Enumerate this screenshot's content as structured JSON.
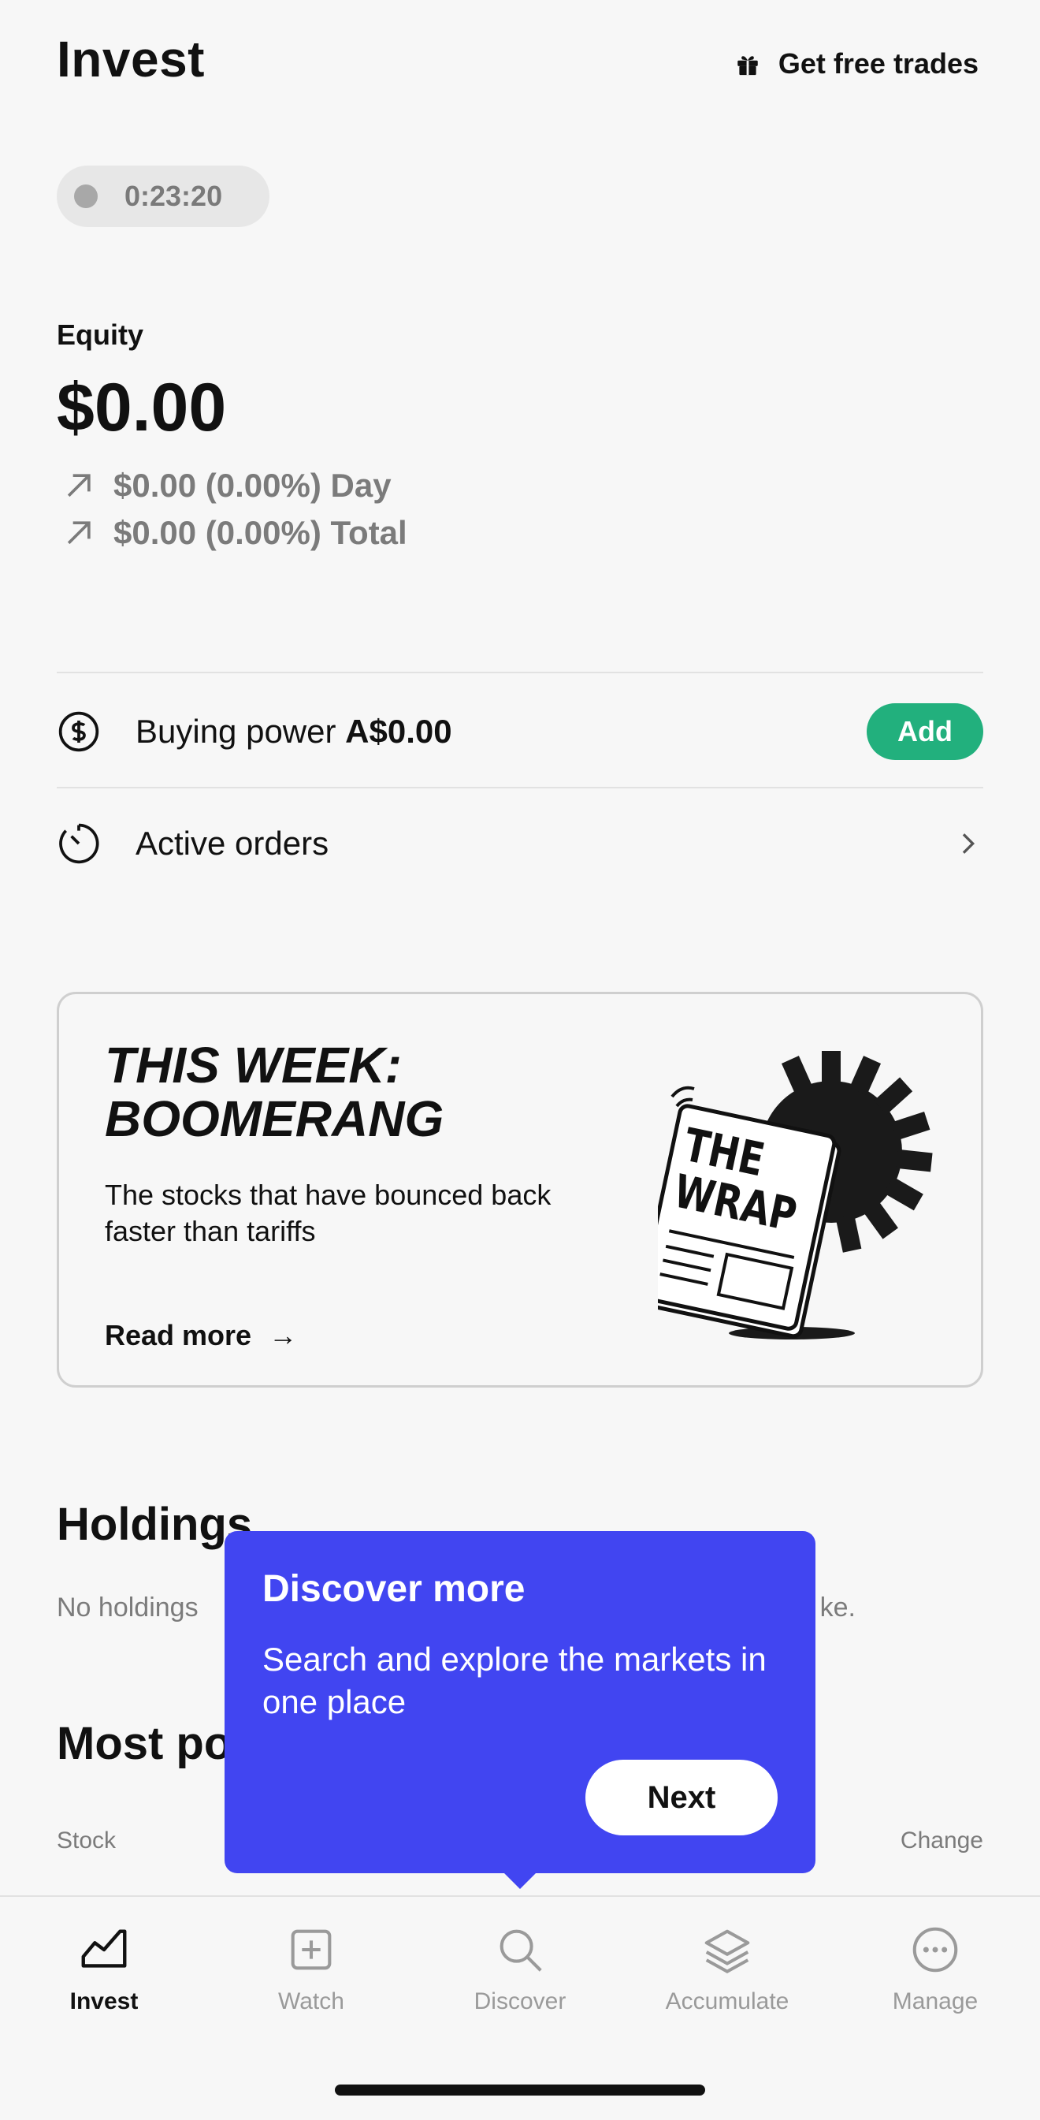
{
  "header": {
    "title": "Invest",
    "free_trades_label": "Get free trades"
  },
  "timer": {
    "value": "0:23:20"
  },
  "equity": {
    "label": "Equity",
    "value": "$0.00",
    "day_change": "$0.00 (0.00%) Day",
    "total_change": "$0.00 (0.00%) Total"
  },
  "buying_power": {
    "label": "Buying power",
    "amount": "A$0.00",
    "add_label": "Add"
  },
  "active_orders": {
    "label": "Active orders"
  },
  "promo_card": {
    "title_line1": "THIS WEEK:",
    "title_line2": "BOOMERANG",
    "subtitle_line1": "The stocks that have bounced back",
    "subtitle_line2": "faster than tariffs",
    "link_label": "Read more",
    "link_arrow": "→",
    "art_text_line1": "THE",
    "art_text_line2": "WRAP"
  },
  "holdings": {
    "title": "Holdings",
    "empty_text_start": "No holdings",
    "empty_text_end": "ke."
  },
  "most_popular": {
    "title_partial": "Most po",
    "col_stock": "Stock",
    "col_change": "Change"
  },
  "tooltip": {
    "title": "Discover more",
    "body": "Search and explore the markets in one place",
    "next_label": "Next"
  },
  "tabbar": {
    "tabs": [
      {
        "label": "Invest",
        "icon": "chart-icon",
        "active": true
      },
      {
        "label": "Watch",
        "icon": "plus-square-icon",
        "active": false
      },
      {
        "label": "Discover",
        "icon": "search-icon",
        "active": false
      },
      {
        "label": "Accumulate",
        "icon": "layers-icon",
        "active": false
      },
      {
        "label": "Manage",
        "icon": "more-icon",
        "active": false
      }
    ]
  },
  "colors": {
    "accent_green": "#22b07d",
    "tooltip_blue": "#4145f1",
    "background": "#f7f7f7"
  }
}
